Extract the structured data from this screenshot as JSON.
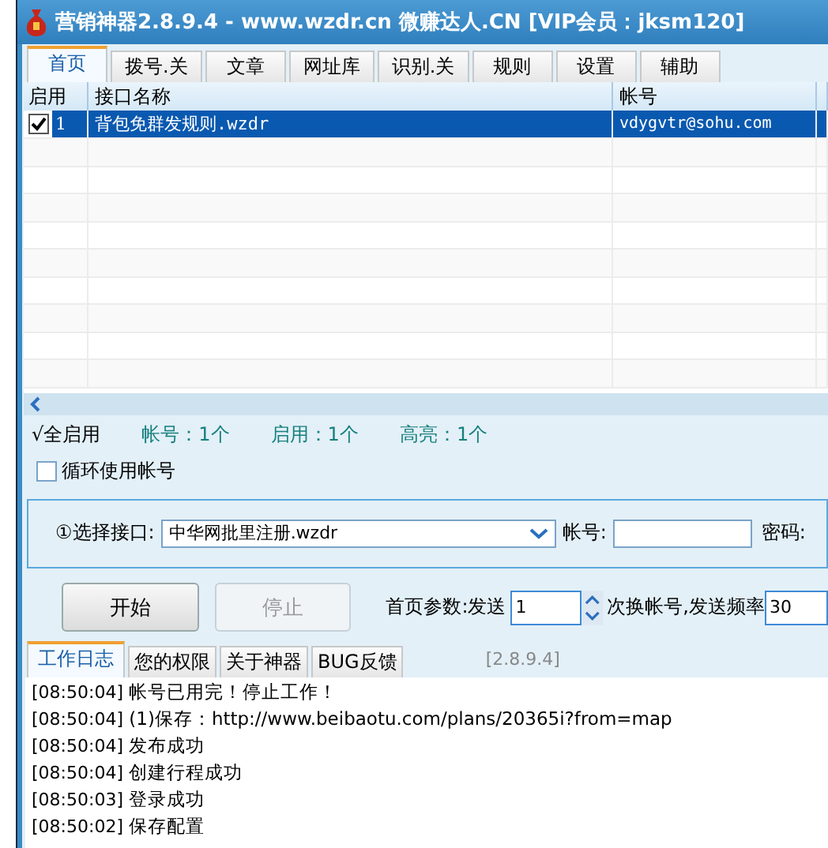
{
  "window": {
    "title": "营销神器2.8.9.4 - www.wzdr.cn 微赚达人.CN [VIP会员：jksm120]"
  },
  "tabs": [
    {
      "label": "首页",
      "selected": true
    },
    {
      "label": "拨号.关",
      "selected": false
    },
    {
      "label": "文章",
      "selected": false
    },
    {
      "label": "网址库",
      "selected": false
    },
    {
      "label": "识别.关",
      "selected": false
    },
    {
      "label": "规则",
      "selected": false
    },
    {
      "label": "设置",
      "selected": false
    },
    {
      "label": "辅助",
      "selected": false
    }
  ],
  "table": {
    "columns": [
      "启用",
      "接口名称",
      "帐号"
    ],
    "rows": [
      {
        "checked": true,
        "index": "1",
        "name": "背包免群发规则.wzdr",
        "account": "vdygvtr@sohu.com",
        "selected": true
      }
    ]
  },
  "summary": {
    "enable_all": "√全启用",
    "stats": [
      "帐号：1个",
      "启用：1个",
      "高亮：1个"
    ]
  },
  "loop_checkbox": {
    "label": "循环使用帐号",
    "checked": false
  },
  "interface": {
    "label": "①选择接口:",
    "value": "中华网批里注册.wzdr",
    "account_label": "帐号:",
    "password_label": "密码:"
  },
  "buttons": [
    {
      "label": "开始",
      "disabled": false
    },
    {
      "label": "停止",
      "disabled": true
    }
  ],
  "params": {
    "label": "首页参数:发送",
    "count": "1",
    "middle": "次换帐号,发送频率",
    "rate": "30"
  },
  "log_tabs": [
    {
      "label": "工作日志",
      "selected": true
    },
    {
      "label": "您的权限",
      "selected": false
    },
    {
      "label": "关于神器",
      "selected": false
    },
    {
      "label": "BUG反馈",
      "selected": false
    }
  ],
  "version": "[2.8.9.4]",
  "log": [
    {
      "time": "[08:50:04]",
      "text": "帐号已用完！停止工作！"
    },
    {
      "time": "[08:50:04]",
      "text": "(1)保存：http://www.beibaotu.com/plans/20365i?from=map"
    },
    {
      "time": "[08:50:04]",
      "text": "发布成功"
    },
    {
      "time": "[08:50:04]",
      "text": "创建行程成功"
    },
    {
      "time": "[08:50:03]",
      "text": "登录成功"
    },
    {
      "time": "[08:50:02]",
      "text": "保存配置"
    }
  ]
}
